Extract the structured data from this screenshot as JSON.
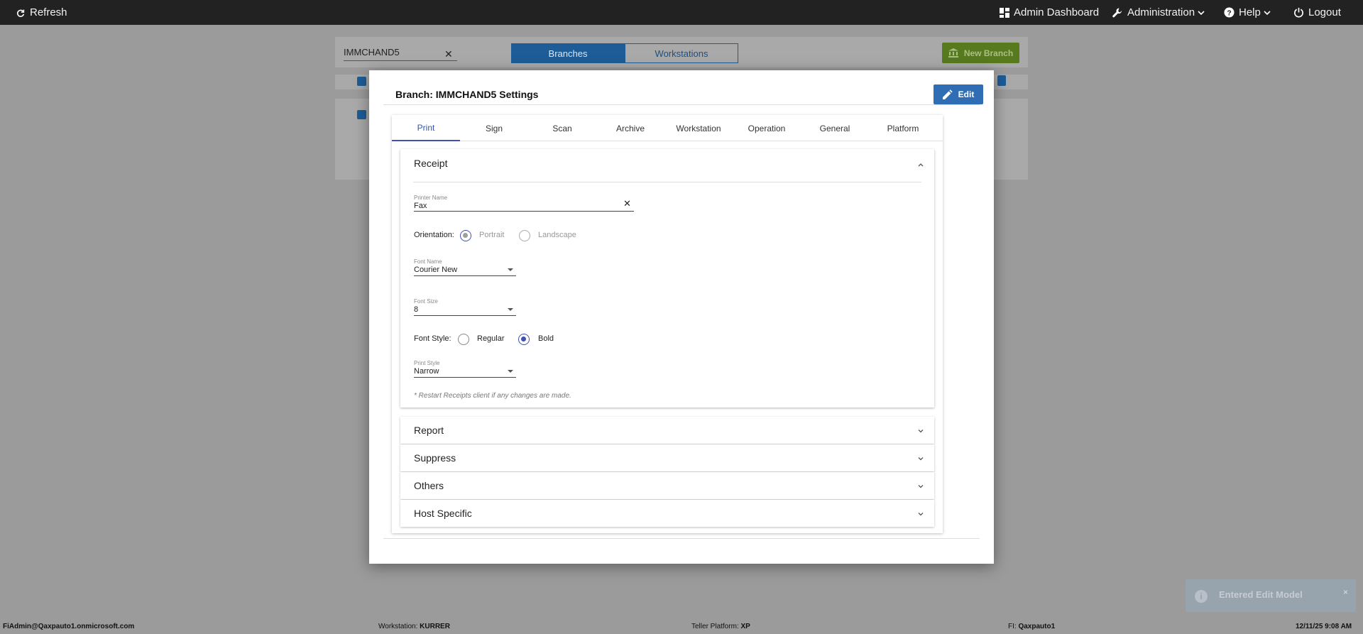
{
  "topbar": {
    "refresh": "Refresh",
    "admin_dashboard": "Admin Dashboard",
    "administration": "Administration",
    "help": "Help",
    "logout": "Logout"
  },
  "background": {
    "search_value": "IMMCHAND5",
    "segments": [
      "Branches",
      "Workstations"
    ],
    "new_branch": "New Branch"
  },
  "modal": {
    "title": "Branch: IMMCHAND5 Settings",
    "edit_label": "Edit",
    "tabs": [
      "Print",
      "Sign",
      "Scan",
      "Archive",
      "Workstation",
      "Operation",
      "General",
      "Platform"
    ],
    "active_tab": "Print",
    "receipt": {
      "title": "Receipt",
      "printer_name_label": "Printer Name",
      "printer_name_value": "Fax",
      "orientation_label": "Orientation:",
      "orientation_options": [
        "Portrait",
        "Landscape"
      ],
      "orientation_selected": "Portrait",
      "font_name_label": "Font Name",
      "font_name_value": "Courier New",
      "font_size_label": "Font Size",
      "font_size_value": "8",
      "font_style_label": "Font Style:",
      "font_style_options": [
        "Regular",
        "Bold"
      ],
      "font_style_selected": "Bold",
      "print_style_label": "Print Style",
      "print_style_value": "Narrow",
      "note": "* Restart Receipts client if any changes are made."
    },
    "collapsed_panels": [
      "Report",
      "Suppress",
      "Others",
      "Host Specific"
    ]
  },
  "toast": {
    "message": "Entered Edit Model",
    "close": "×"
  },
  "footer": {
    "user": "FiAdmin@Qaxpauto1.onmicrosoft.com",
    "workstation_label": "Workstation:",
    "workstation_value": "KURRER",
    "teller_platform_label": "Teller Platform:",
    "teller_platform_value": "XP",
    "fi_label": "FI:",
    "fi_value": "Qaxpauto1",
    "datetime": "12/11/25 9:08 AM"
  },
  "colors": {
    "nav_bg": "#222222",
    "primary": "#2f6db5",
    "tab_indicator": "#3f51b5",
    "new_branch_green": "#7cb342"
  }
}
